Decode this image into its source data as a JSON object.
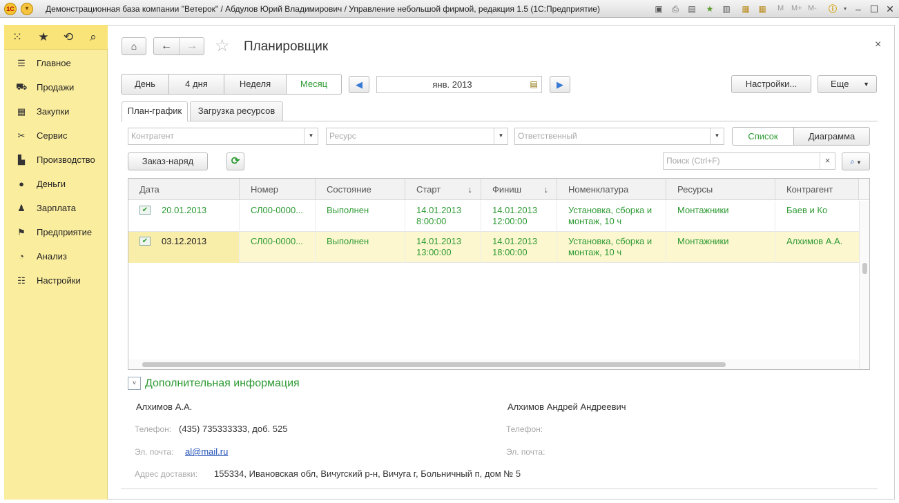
{
  "window": {
    "title": "Демонстрационная база компании \"Ветерок\" / Абдулов Юрий Владимирович / Управление небольшой фирмой, редакция 1.5  (1С:Предприятие)",
    "logo_text": "1С",
    "m_labels": [
      "M",
      "M+",
      "M-"
    ]
  },
  "sidebar": {
    "items": [
      {
        "label": "Главное",
        "icon": "menu-icon"
      },
      {
        "label": "Продажи",
        "icon": "basket-icon"
      },
      {
        "label": "Закупки",
        "icon": "purchases-icon"
      },
      {
        "label": "Сервис",
        "icon": "tools-icon"
      },
      {
        "label": "Производство",
        "icon": "factory-icon"
      },
      {
        "label": "Деньги",
        "icon": "coin-icon"
      },
      {
        "label": "Зарплата",
        "icon": "people-icon"
      },
      {
        "label": "Предприятие",
        "icon": "flag-icon"
      },
      {
        "label": "Анализ",
        "icon": "pie-chart-icon"
      },
      {
        "label": "Настройки",
        "icon": "settings-icon"
      }
    ]
  },
  "page": {
    "title": "Планировщик",
    "close": "×"
  },
  "period": {
    "buttons": [
      "День",
      "4 дня",
      "Неделя",
      "Месяц"
    ],
    "active": "Месяц",
    "date_value": "янв. 2013",
    "settings_label": "Настройки...",
    "more_label": "Еще"
  },
  "tabs": [
    "План-график",
    "Загрузка ресурсов"
  ],
  "filters": {
    "contractor_placeholder": "Контрагент",
    "resource_placeholder": "Ресурс",
    "responsible_placeholder": "Ответственный",
    "view_list": "Список",
    "view_diagram": "Диаграмма"
  },
  "actions": {
    "order_label": "Заказ-наряд",
    "search_placeholder": "Поиск (Ctrl+F)",
    "clear": "×"
  },
  "table": {
    "headers": [
      "Дата",
      "Номер",
      "Состояние",
      "Старт",
      "Финиш",
      "Номенклатура",
      "Ресурсы",
      "Контрагент"
    ],
    "sort_arrow": "↓",
    "rows": [
      {
        "date": "20.01.2013",
        "number": "СЛ00-0000...",
        "state": "Выполнен",
        "start_date": "14.01.2013",
        "start_time": "8:00:00",
        "finish_date": "14.01.2013",
        "finish_time": "12:00:00",
        "item_line1": "Установка, сборка и",
        "item_line2": "монтаж, 10 ч",
        "resources": "Монтажники",
        "contractor": "Баев и Ко"
      },
      {
        "date": "03.12.2013",
        "number": "СЛ00-0000...",
        "state": "Выполнен",
        "start_date": "14.01.2013",
        "start_time": "13:00:00",
        "finish_date": "14.01.2013",
        "finish_time": "18:00:00",
        "item_line1": "Установка, сборка и",
        "item_line2": "монтаж, 10 ч",
        "resources": "Монтажники",
        "contractor": "Алхимов А.А."
      }
    ]
  },
  "additional": {
    "title": "Дополнительная информация",
    "left": {
      "name": "Алхимов А.А.",
      "phone_label": "Телефон:",
      "phone": "(435) 735333333, доб. 525",
      "email_label": "Эл. почта:",
      "email": "al@mail.ru",
      "address_label": "Адрес доставки:",
      "address": "155334, Ивановская обл, Вичугский р-н, Вичуга г, Больничный п, дом № 5"
    },
    "right": {
      "name": "Алхимов Андрей Андреевич",
      "phone_label": "Телефон:",
      "email_label": "Эл. почта:"
    }
  },
  "colors": {
    "accent_green": "#2d9a33",
    "sidebar_bg": "#fbed9e",
    "selected_row": "#fcf7cf"
  }
}
